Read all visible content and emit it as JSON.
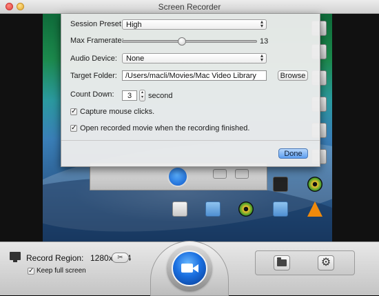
{
  "window": {
    "title": "Screen Recorder"
  },
  "settings": {
    "session_preset_label": "Session Preset:",
    "session_preset_value": "High",
    "max_framerate_label": "Max Framerate:",
    "max_framerate_value": "13",
    "max_framerate_level": 0.44,
    "audio_device_label": "Audio Device:",
    "audio_device_value": "None",
    "target_folder_label": "Target Folder:",
    "target_folder_value": "/Users/macli/Movies/Mac Video Library",
    "browse_label": "Browse",
    "count_down_label": "Count Down:",
    "count_down_value": "3",
    "count_down_unit": "second",
    "capture_mouse_label": "Capture mouse clicks.",
    "capture_mouse_checked": true,
    "open_movie_label": "Open recorded movie when the recording finished.",
    "open_movie_checked": true,
    "done_label": "Done"
  },
  "bottom_bar": {
    "record_region_label": "Record Region:",
    "record_region_value": "1280x1024",
    "keep_full_screen_label": "Keep full screen",
    "keep_full_screen_checked": true
  },
  "icons": {
    "record": "video-camera-icon",
    "region": "scissors-icon",
    "display": "monitor-icon",
    "open_folder": "folder-icon",
    "settings": "gear-icon"
  }
}
